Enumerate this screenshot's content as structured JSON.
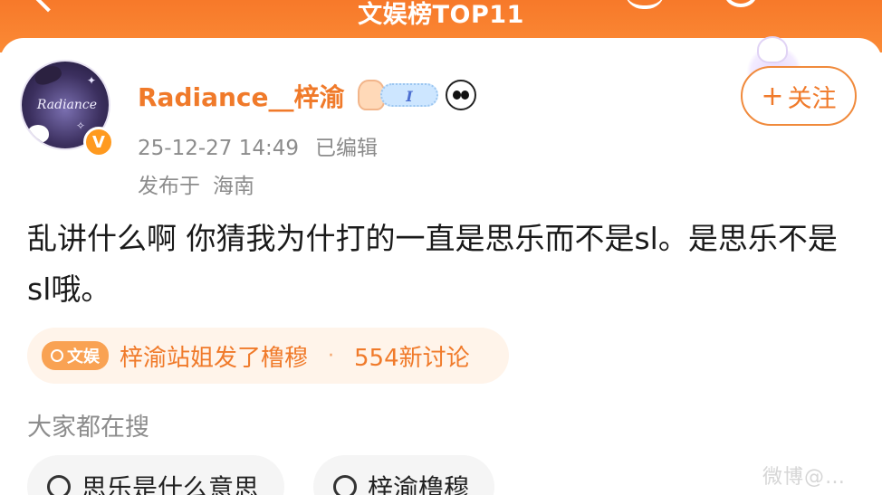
{
  "header": {
    "title": "文娱榜TOP11"
  },
  "author": {
    "name": "Radiance__梓渝",
    "avatar_text": "Radiance",
    "verified_mark": "V",
    "badge_cloud_text": "I"
  },
  "post_meta": {
    "time": "25-12-27 14:49",
    "edited": "已编辑",
    "location_prefix": "发布于",
    "location": "海南"
  },
  "follow": {
    "plus": "+",
    "label": "关注"
  },
  "post": {
    "text": "乱讲什么啊 你猜我为什打的一直是思乐而不是sl。是思乐不是sl哦。"
  },
  "topic": {
    "tag": "文娱",
    "title": "梓渝站姐发了橹穆",
    "separator": "·",
    "count": "554新讨论"
  },
  "hot_search": {
    "header": "大家都在搜",
    "items": [
      {
        "label": "思乐是什么意思"
      },
      {
        "label": "梓渝橹穆"
      }
    ]
  },
  "watermark": "微博@…"
}
